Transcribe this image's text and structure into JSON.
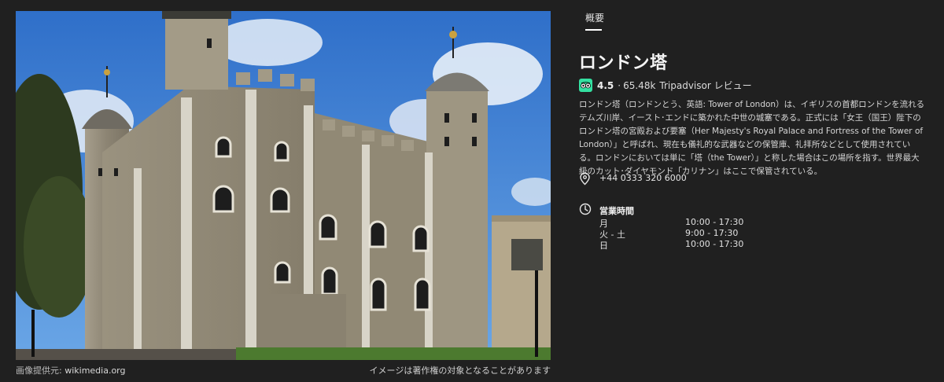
{
  "image_panel": {
    "credit_label": "画像提供元:",
    "credit_source": "wikimedia.org",
    "copyright_notice": "イメージは著作権の対象となることがあります"
  },
  "info_panel": {
    "tab_label": "概要",
    "title": "ロンドン塔",
    "rating": {
      "score": "4.5",
      "separator": "·",
      "count": "65.48k",
      "provider": "Tripadvisor レビュー",
      "provider_icon": "tripadvisor-owl-icon",
      "provider_color": "#34e0a1"
    },
    "description": "ロンドン塔（ロンドンとう、英語: Tower of London）は、イギリスの首都ロンドンを流れるテムズ川岸、イースト･エンドに築かれた中世の城塞である。正式には「女王（国王）陛下のロンドン塔の宮殿および要塞（Her Majesty's Royal Palace and Fortress of the Tower of London）」と呼ばれ、現在も儀礼的な武器などの保管庫、礼拝所などとして使用されている。ロンドンにおいては単に「塔（the Tower）」と称した場合はこの場所を指す。世界最大級のカット･ダイヤモンド「カリナン」はここで保管されている。",
    "phone": {
      "icon": "location-pin-icon",
      "text": "+44 0333 320 6000"
    },
    "hours": {
      "icon": "clock-icon",
      "title": "営業時間",
      "rows": [
        {
          "day": "月",
          "time": "10:00 - 17:30"
        },
        {
          "day": "火 - 土",
          "time": "9:00 - 17:30"
        },
        {
          "day": "日",
          "time": "10:00 - 17:30"
        }
      ]
    }
  }
}
